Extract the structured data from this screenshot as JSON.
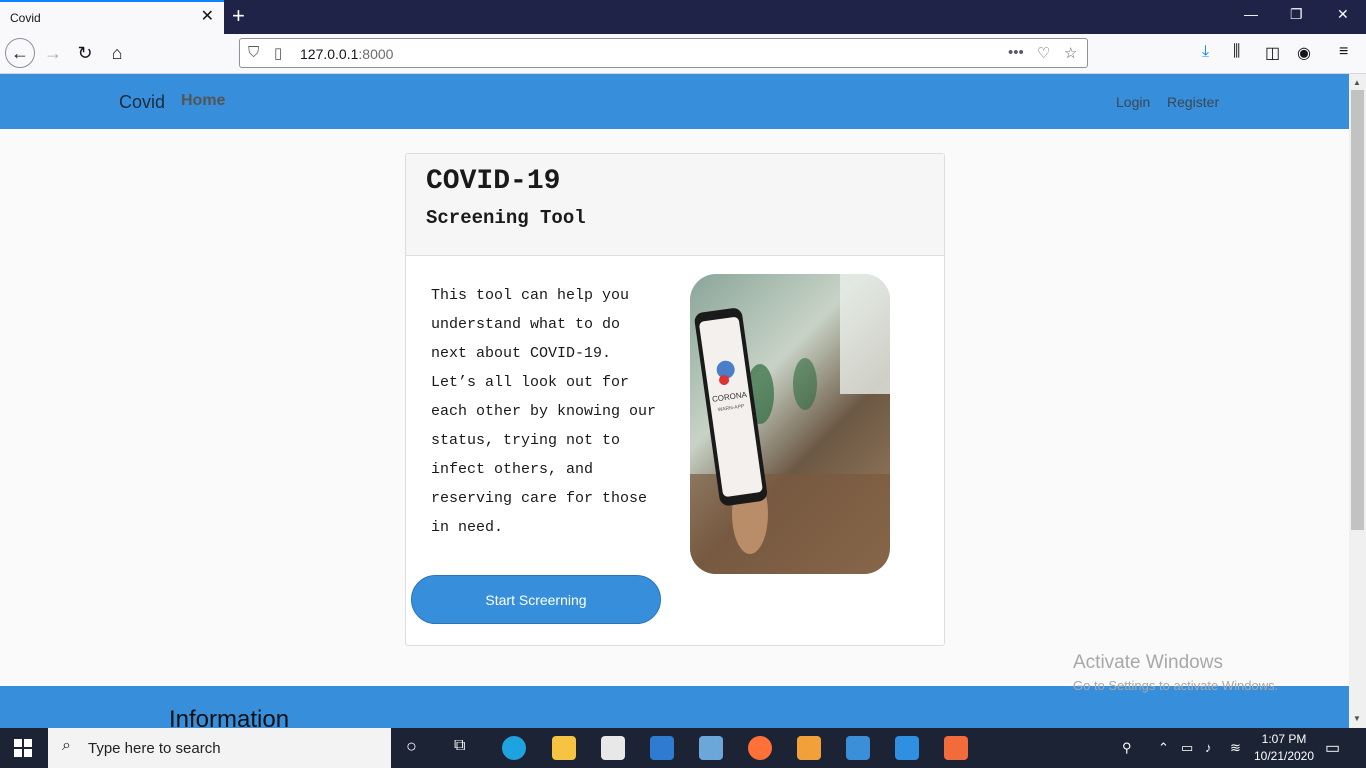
{
  "browser": {
    "tab_title": "Covid",
    "url_host": "127.0.0.1",
    "url_port": ":8000"
  },
  "site": {
    "brand": "Covid",
    "nav_home": "Home",
    "nav_login": "Login",
    "nav_register": "Register"
  },
  "card": {
    "title": "COVID-19",
    "subtitle": "Screening Tool",
    "body": "This tool can help you understand what to do next about COVID-19. Let’s all look out for each other by knowing our status, trying not to infect others, and reserving care for those in need.",
    "image_phone_text": "CORONA",
    "image_phone_subtext": "WARN-APP",
    "button_label": "Start Screerning"
  },
  "info": {
    "title": "Information"
  },
  "watermark": {
    "title": "Activate Windows",
    "subtitle": "Go to Settings to activate Windows."
  },
  "taskbar": {
    "search_placeholder": "Type here to search",
    "time": "1:07 PM",
    "date": "10/21/2020"
  },
  "colors": {
    "accent": "#378fdc",
    "tab_strip": "#1f2347",
    "taskbar": "#1b2334"
  }
}
